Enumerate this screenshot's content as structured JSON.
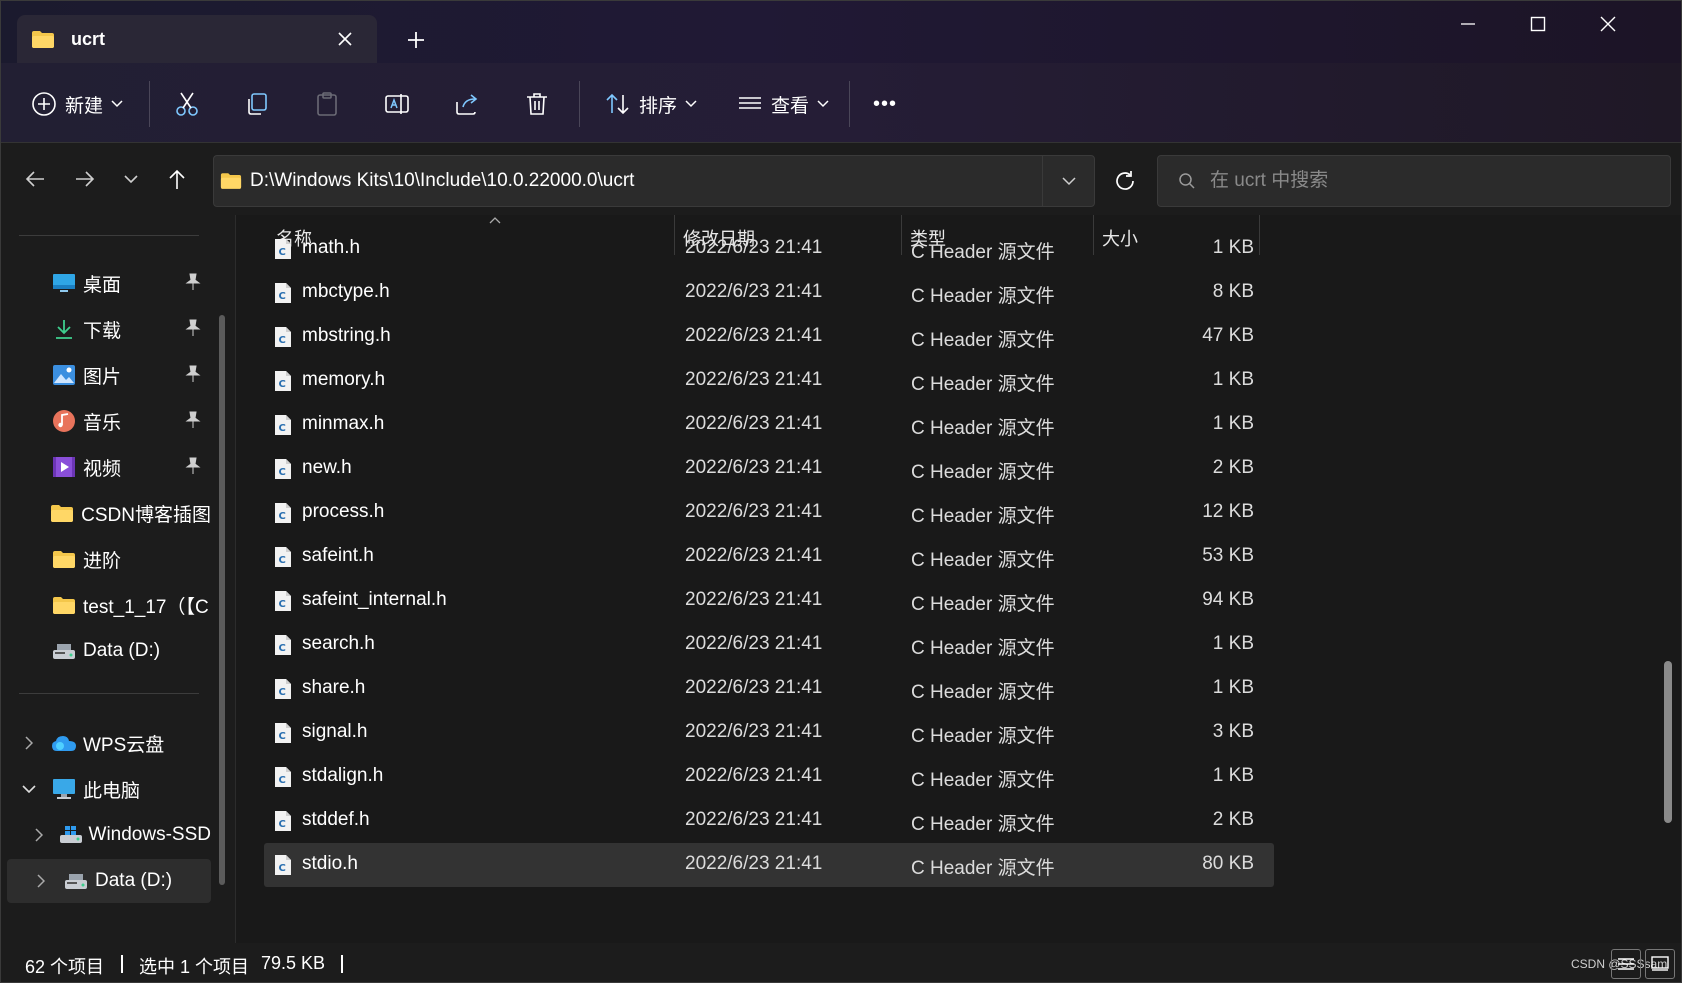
{
  "window": {
    "tab_title": "ucrt",
    "controls": [
      "minimize",
      "maximize",
      "close"
    ]
  },
  "toolbar": {
    "new_label": "新建",
    "sort_label": "排序",
    "view_label": "查看",
    "more_label": "•••"
  },
  "address": {
    "path": "D:\\Windows Kits\\10\\Include\\10.0.22000.0\\ucrt",
    "search_placeholder": "在 ucrt 中搜索"
  },
  "sidebar": {
    "quick_access": [
      {
        "label": "桌面",
        "icon": "desktop-icon",
        "pinned": true
      },
      {
        "label": "下载",
        "icon": "download-icon",
        "pinned": true
      },
      {
        "label": "图片",
        "icon": "pictures-icon",
        "pinned": true
      },
      {
        "label": "音乐",
        "icon": "music-icon",
        "pinned": true
      },
      {
        "label": "视频",
        "icon": "videos-icon",
        "pinned": true
      },
      {
        "label": "CSDN博客插图",
        "icon": "folder-icon",
        "pinned": false
      },
      {
        "label": "进阶",
        "icon": "folder-icon",
        "pinned": false
      },
      {
        "label": "test_1_17（【C",
        "icon": "folder-icon",
        "pinned": false
      },
      {
        "label": "Data (D:)",
        "icon": "drive-icon",
        "pinned": false
      }
    ],
    "tree": [
      {
        "label": "WPS云盘",
        "icon": "cloud-icon",
        "expanded": false
      },
      {
        "label": "此电脑",
        "icon": "computer-icon",
        "expanded": true
      },
      {
        "label": "Windows-SSD",
        "icon": "windows-drive-icon",
        "expanded": false
      },
      {
        "label": "Data (D:)",
        "icon": "drive-icon",
        "expanded": false
      }
    ]
  },
  "columns": {
    "name": "名称",
    "date": "修改日期",
    "type": "类型",
    "size": "大小"
  },
  "files": [
    {
      "name": "math.h",
      "date": "2022/6/23 21:41",
      "type": "C Header 源文件",
      "size": "1 KB"
    },
    {
      "name": "mbctype.h",
      "date": "2022/6/23 21:41",
      "type": "C Header 源文件",
      "size": "8 KB"
    },
    {
      "name": "mbstring.h",
      "date": "2022/6/23 21:41",
      "type": "C Header 源文件",
      "size": "47 KB"
    },
    {
      "name": "memory.h",
      "date": "2022/6/23 21:41",
      "type": "C Header 源文件",
      "size": "1 KB"
    },
    {
      "name": "minmax.h",
      "date": "2022/6/23 21:41",
      "type": "C Header 源文件",
      "size": "1 KB"
    },
    {
      "name": "new.h",
      "date": "2022/6/23 21:41",
      "type": "C Header 源文件",
      "size": "2 KB"
    },
    {
      "name": "process.h",
      "date": "2022/6/23 21:41",
      "type": "C Header 源文件",
      "size": "12 KB"
    },
    {
      "name": "safeint.h",
      "date": "2022/6/23 21:41",
      "type": "C Header 源文件",
      "size": "53 KB"
    },
    {
      "name": "safeint_internal.h",
      "date": "2022/6/23 21:41",
      "type": "C Header 源文件",
      "size": "94 KB"
    },
    {
      "name": "search.h",
      "date": "2022/6/23 21:41",
      "type": "C Header 源文件",
      "size": "1 KB"
    },
    {
      "name": "share.h",
      "date": "2022/6/23 21:41",
      "type": "C Header 源文件",
      "size": "1 KB"
    },
    {
      "name": "signal.h",
      "date": "2022/6/23 21:41",
      "type": "C Header 源文件",
      "size": "3 KB"
    },
    {
      "name": "stdalign.h",
      "date": "2022/6/23 21:41",
      "type": "C Header 源文件",
      "size": "1 KB"
    },
    {
      "name": "stddef.h",
      "date": "2022/6/23 21:41",
      "type": "C Header 源文件",
      "size": "2 KB"
    },
    {
      "name": "stdio.h",
      "date": "2022/6/23 21:41",
      "type": "C Header 源文件",
      "size": "80 KB",
      "selected": true
    }
  ],
  "status": {
    "item_count": "62 个项目",
    "selection": "选中 1 个项目",
    "selection_size": "79.5 KB"
  },
  "watermark": "CSDN @SSSsam",
  "colors": {
    "folder": "#f4c74b",
    "accent": "#4cc2ff",
    "selected_row": "#333333"
  }
}
